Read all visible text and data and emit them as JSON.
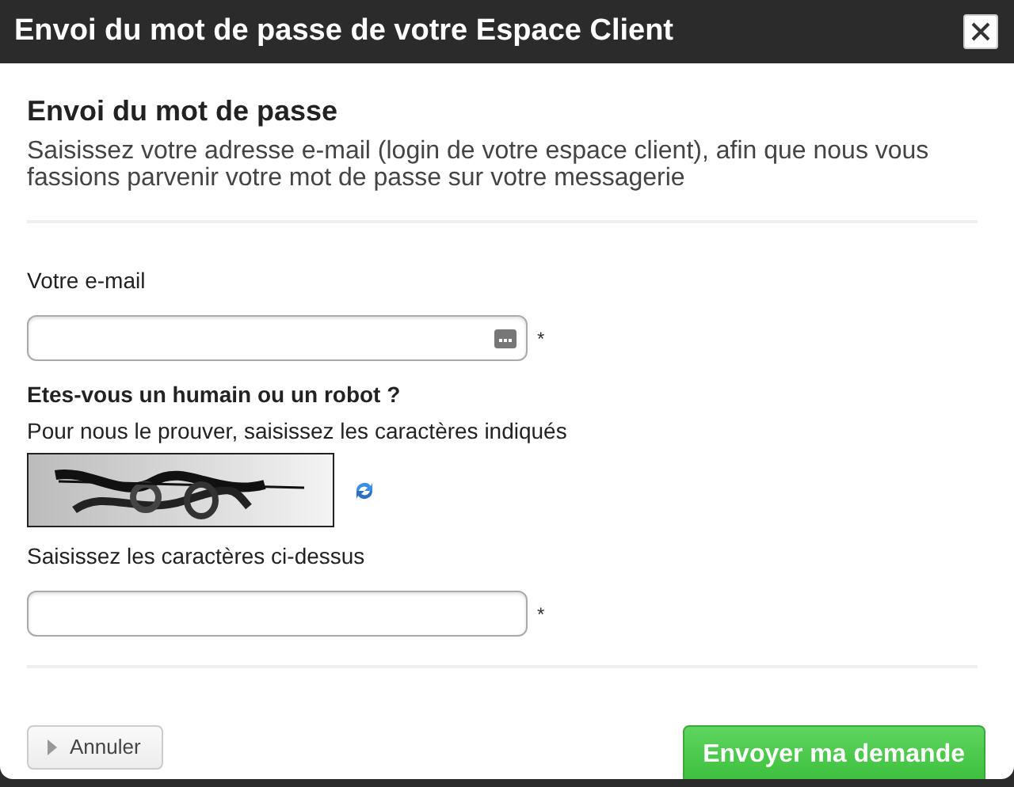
{
  "window": {
    "title": "Envoi du mot de passe de votre Espace Client"
  },
  "heading": "Envoi du mot de passe",
  "intro": "Saisissez votre adresse e-mail (login de votre espace client), afin que nous vous fassions parvenir votre mot de passe sur votre messagerie",
  "email": {
    "label": "Votre e-mail",
    "required_mark": "*"
  },
  "captcha": {
    "title": "Etes-vous un humain ou un robot ?",
    "hint": "Pour nous le prouver, saisissez les caractères indiqués",
    "label": "Saisissez les caractères ci-dessus",
    "required_mark": "*"
  },
  "buttons": [
    {
      "kind": "secondary",
      "label": "Annuler"
    },
    {
      "kind": "primary",
      "label": "Envoyer ma demande"
    }
  ]
}
